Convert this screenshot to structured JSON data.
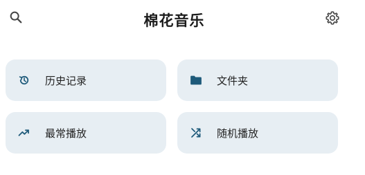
{
  "header": {
    "title": "棉花音乐",
    "search_icon": "search-icon",
    "settings_icon": "gear-icon"
  },
  "cards": [
    {
      "label": "历史记录",
      "icon": "history-icon"
    },
    {
      "label": "文件夹",
      "icon": "folder-icon"
    },
    {
      "label": "最常播放",
      "icon": "trending-up-icon"
    },
    {
      "label": "随机播放",
      "icon": "shuffle-icon"
    }
  ],
  "colors": {
    "card_background": "#e7eef3",
    "accent_icon": "#1e5a7a",
    "text": "#232323"
  }
}
